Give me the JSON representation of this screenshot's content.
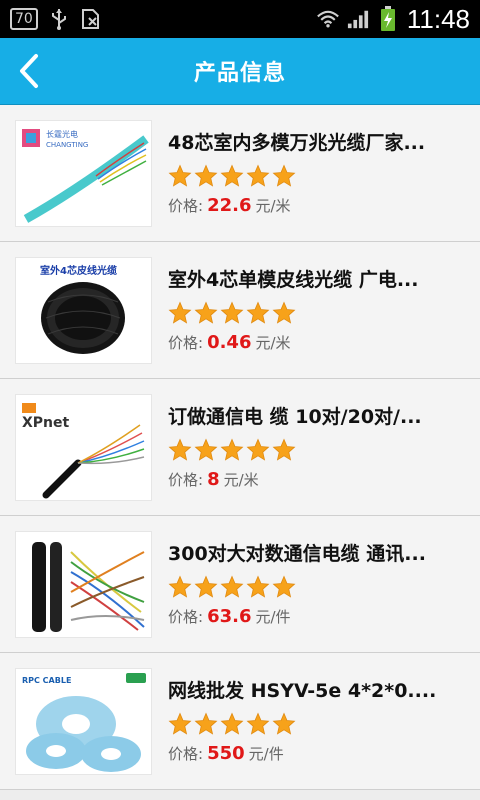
{
  "status_bar": {
    "badge": "70",
    "time": "11:48"
  },
  "header": {
    "title": "产品信息"
  },
  "products": [
    {
      "name": "48芯室内多模万兆光缆厂家...",
      "rating": 5,
      "price_label": "价格:",
      "price": "22.6",
      "unit": "元/米",
      "thumb_logo": "长霆光电\nCHANGTING"
    },
    {
      "name": "室外4芯单模皮线光缆 广电...",
      "rating": 5,
      "price_label": "价格:",
      "price": "0.46",
      "unit": "元/米",
      "thumb_logo": "室外4芯皮线光缆"
    },
    {
      "name": "订做通信电 缆 10对/20对/...",
      "rating": 5,
      "price_label": "价格:",
      "price": "8",
      "unit": "元/米",
      "thumb_logo": "XPnet"
    },
    {
      "name": "300对大对数通信电缆 通讯...",
      "rating": 5,
      "price_label": "价格:",
      "price": "63.6",
      "unit": "元/件",
      "thumb_logo": ""
    },
    {
      "name": "网线批发 HSYV-5e 4*2*0....",
      "rating": 5,
      "price_label": "价格:",
      "price": "550",
      "unit": "元/件",
      "thumb_logo": "RPC CABLE"
    }
  ],
  "colors": {
    "accent": "#17aee6",
    "price": "#e01818",
    "star": "#f7a21a"
  }
}
